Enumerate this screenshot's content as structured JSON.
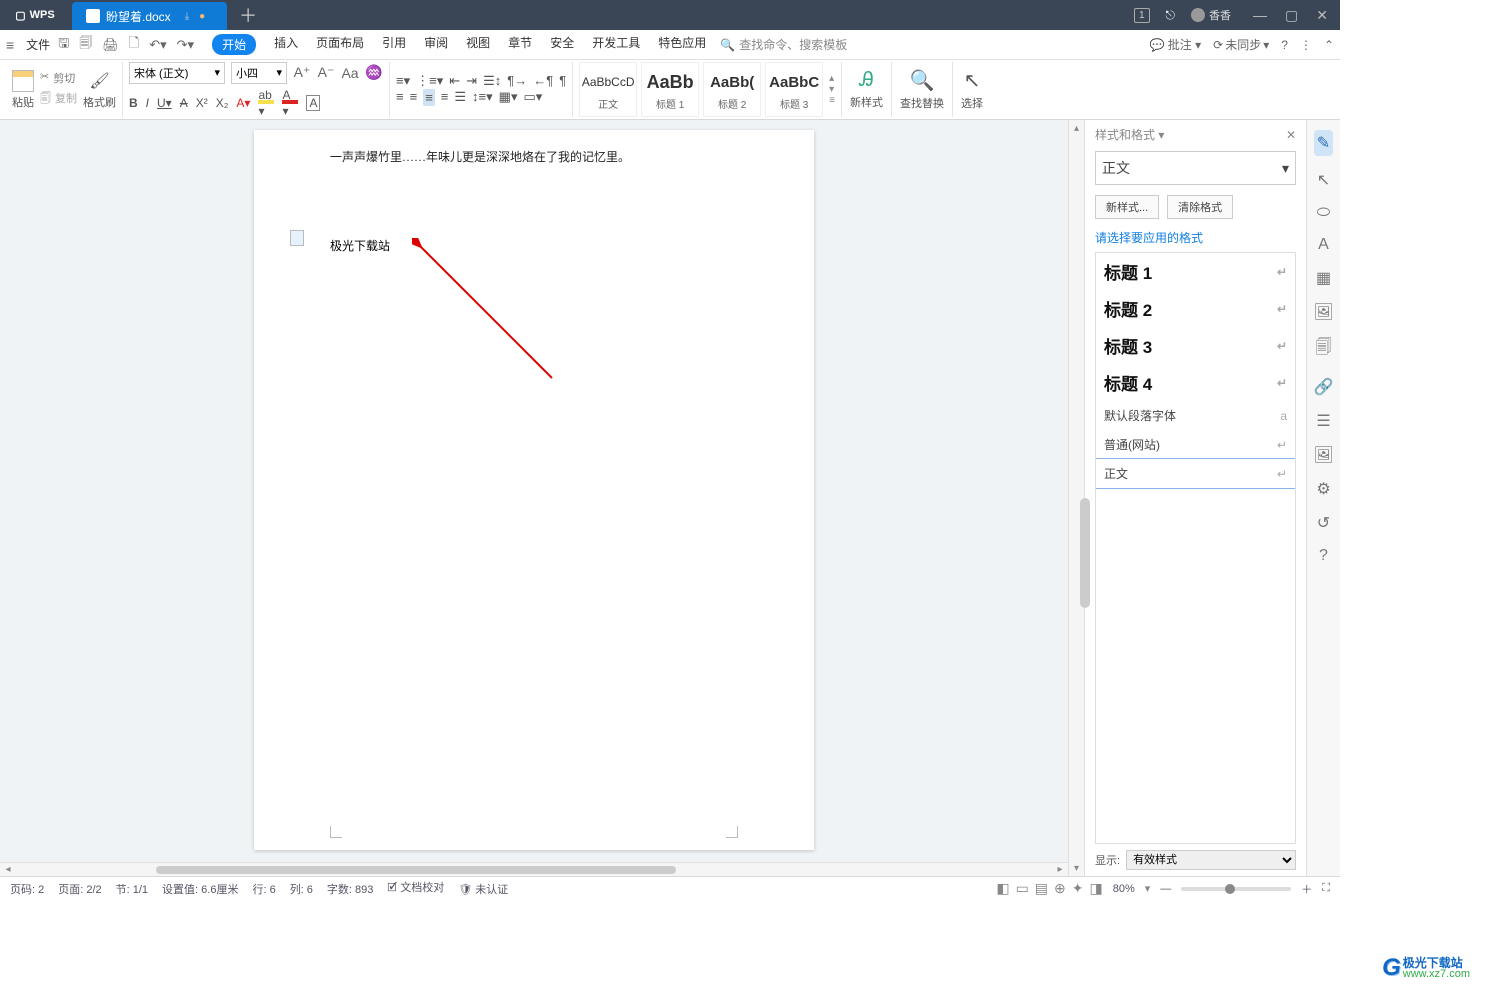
{
  "titlebar": {
    "app": "WPS",
    "tab_label": "盼望着.docx",
    "badge": "1",
    "user": "香香"
  },
  "menubar": {
    "file": "文件",
    "tabs": [
      "开始",
      "插入",
      "页面布局",
      "引用",
      "审阅",
      "视图",
      "章节",
      "安全",
      "开发工具",
      "特色应用"
    ],
    "search_placeholder": "查找命令、搜索模板",
    "annot": "批注",
    "sync": "未同步"
  },
  "ribbon": {
    "paste": "粘贴",
    "cut": "剪切",
    "copy": "复制",
    "format_painter": "格式刷",
    "font_name": "宋体 (正文)",
    "font_size": "小四",
    "styles": [
      {
        "preview": "AaBbCcD",
        "label": "正文",
        "cls": ""
      },
      {
        "preview": "AaBb",
        "label": "标题 1",
        "cls": "big"
      },
      {
        "preview": "AaBb(",
        "label": "标题 2",
        "cls": "med"
      },
      {
        "preview": "AaBbC",
        "label": "标题 3",
        "cls": "med"
      }
    ],
    "new_style": "新样式",
    "find_replace": "查找替换",
    "select": "选择"
  },
  "document": {
    "line1": "一声声爆竹里……年味儿更是深深地烙在了我的记忆里。",
    "line2": "极光下载站"
  },
  "style_panel": {
    "title": "样式和格式",
    "current": "正文",
    "btn_new": "新样式...",
    "btn_clear": "清除格式",
    "hint": "请选择要应用的格式",
    "items": [
      {
        "label": "标题 1",
        "heading": true
      },
      {
        "label": "标题 2",
        "heading": true
      },
      {
        "label": "标题 3",
        "heading": true
      },
      {
        "label": "标题 4",
        "heading": true
      },
      {
        "label": "默认段落字体",
        "heading": false,
        "glyph": "a"
      },
      {
        "label": "普通(网站)",
        "heading": false
      },
      {
        "label": "正文",
        "heading": false,
        "selected": true
      }
    ],
    "show_label": "显示:",
    "show_value": "有效样式"
  },
  "statusbar": {
    "page_no": "页码: 2",
    "page": "页面: 2/2",
    "section": "节: 1/1",
    "pos": "设置值: 6.6厘米",
    "row": "行: 6",
    "col": "列: 6",
    "words": "字数: 893",
    "doc_check": "文档校对",
    "unverified": "未认证",
    "zoom": "80%"
  },
  "watermark": {
    "logo": "G",
    "cn": "极光下载站",
    "url": "www.xz7.com"
  }
}
